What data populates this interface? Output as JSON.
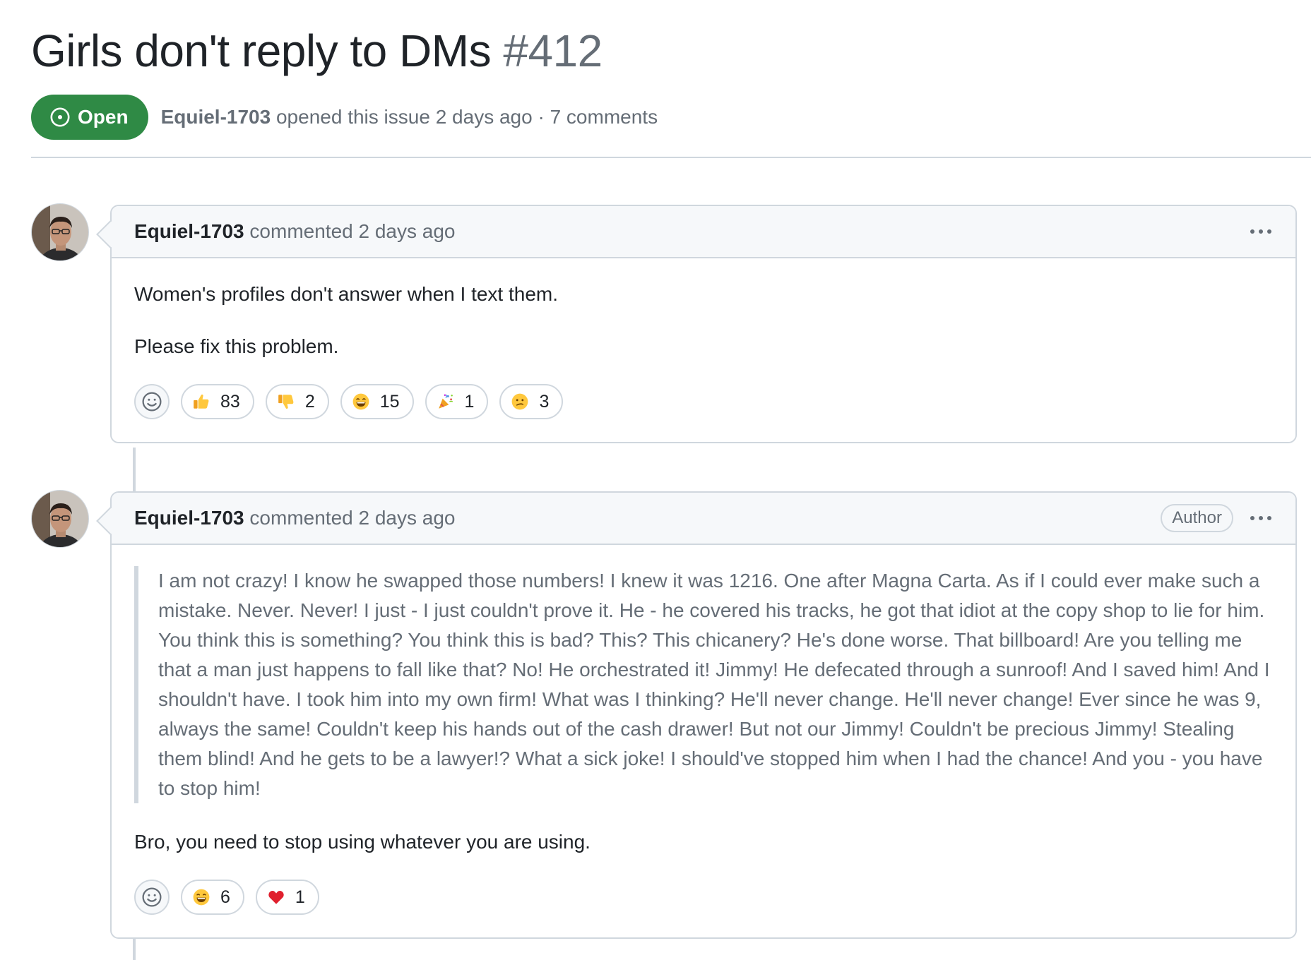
{
  "issue": {
    "title": "Girls don't reply to DMs",
    "number": "#412",
    "state": "Open",
    "author": "Equiel-1703",
    "meta": "opened this issue 2 days ago · 7 comments"
  },
  "colors": {
    "open_green": "#2f8a45",
    "border": "#d0d7de",
    "muted_text": "#656d76",
    "header_bg": "#f6f8fa"
  },
  "comments": [
    {
      "author": "Equiel-1703",
      "action": "commented 2 days ago",
      "paragraphs": [
        "Women's profiles don't answer when I text them.",
        "Please fix this problem."
      ],
      "reactions": [
        {
          "icon": "thumbs-up-icon",
          "count": "83"
        },
        {
          "icon": "thumbs-down-icon",
          "count": "2"
        },
        {
          "icon": "laugh-icon",
          "count": "15"
        },
        {
          "icon": "hooray-icon",
          "count": "1"
        },
        {
          "icon": "confused-icon",
          "count": "3"
        }
      ]
    },
    {
      "author": "Equiel-1703",
      "action": "commented 2 days ago",
      "badge": "Author",
      "quote": "I am not crazy! I know he swapped those numbers! I knew it was 1216. One after Magna Carta. As if I could ever make such a mistake. Never. Never! I just - I just couldn't prove it. He - he covered his tracks, he got that idiot at the copy shop to lie for him. You think this is something? You think this is bad? This? This chicanery? He's done worse. That billboard! Are you telling me that a man just happens to fall like that? No! He orchestrated it! Jimmy! He defecated through a sunroof! And I saved him! And I shouldn't have. I took him into my own firm! What was I thinking? He'll never change. He'll never change! Ever since he was 9, always the same! Couldn't keep his hands out of the cash drawer! But not our Jimmy! Couldn't be precious Jimmy! Stealing them blind! And he gets to be a lawyer!? What a sick joke! I should've stopped him when I had the chance! And you - you have to stop him!",
      "reply": "Bro, you need to stop using whatever you are using.",
      "reactions": [
        {
          "icon": "laugh-icon",
          "count": "6"
        },
        {
          "icon": "heart-icon",
          "count": "1"
        }
      ]
    }
  ]
}
